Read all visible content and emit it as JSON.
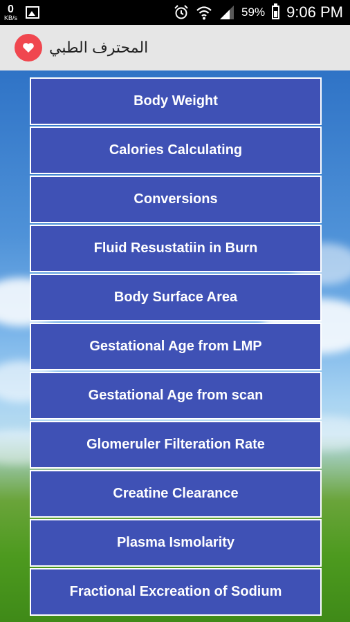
{
  "status_bar": {
    "speed_value": "0",
    "speed_unit": "KB/s",
    "battery_percent": "59%",
    "time": "9:06 PM",
    "icons": [
      "gallery-icon",
      "alarm-icon",
      "wifi-icon",
      "signal-icon",
      "battery-icon"
    ]
  },
  "app_bar": {
    "title": "المحترف الطبي",
    "icon": "heart-icon",
    "accent_color": "#f0474f"
  },
  "menu": {
    "item_color": "#3f51b5",
    "items": [
      {
        "label": "Body Weight"
      },
      {
        "label": "Calories Calculating"
      },
      {
        "label": "Conversions"
      },
      {
        "label": "Fluid Resustatiin in Burn"
      },
      {
        "label": "Body Surface Area"
      },
      {
        "label": "Gestational Age from LMP"
      },
      {
        "label": "Gestational Age from scan"
      },
      {
        "label": "Glomeruler Filteration Rate"
      },
      {
        "label": "Creatine Clearance"
      },
      {
        "label": "Plasma Ismolarity"
      },
      {
        "label": "Fractional Excreation of  Sodium"
      }
    ]
  }
}
